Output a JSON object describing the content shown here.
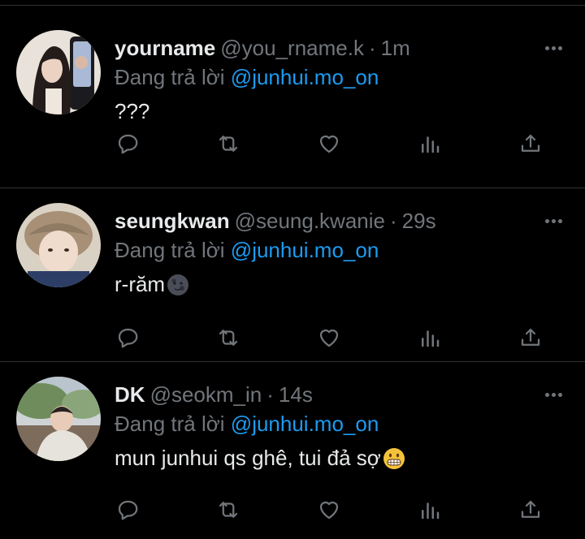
{
  "tweets": [
    {
      "display_name": "yourname",
      "handle": "@you_rname.k",
      "separator": "·",
      "time": "1m",
      "reply_prefix": "Đang trả lời",
      "reply_to": "@junhui.mo_on",
      "text": "???",
      "emoji": "",
      "avatar_colors": [
        "#e8e2da",
        "#2a2220"
      ]
    },
    {
      "display_name": "seungkwan",
      "handle": "@seung.kwanie",
      "separator": "·",
      "time": "29s",
      "reply_prefix": "Đang trả lời",
      "reply_to": "@junhui.mo_on",
      "text": "r-răm",
      "emoji": "new-moon-face",
      "avatar_colors": [
        "#d9d2c4",
        "#8f7b63"
      ]
    },
    {
      "display_name": "DK",
      "handle": "@seokm_in",
      "separator": "·",
      "time": "14s",
      "reply_prefix": "Đang trả lời",
      "reply_to": "@junhui.mo_on",
      "text": "mun junhui qs ghê, tui đả sợ",
      "emoji": "grimacing-face",
      "avatar_colors": [
        "#8aa57a",
        "#cfd3d6"
      ]
    }
  ],
  "colors": {
    "background": "#000000",
    "text": "#e7e9ea",
    "muted": "#71767b",
    "mention": "#1d9bf0",
    "divider": "#2f3336"
  },
  "action_icons": [
    "reply-icon",
    "retweet-icon",
    "like-icon",
    "views-icon",
    "share-icon"
  ]
}
